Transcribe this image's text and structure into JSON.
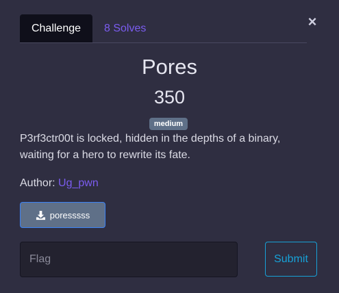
{
  "modal": {
    "close_icon": "close-icon",
    "tabs": [
      {
        "label": "Challenge",
        "active": true
      },
      {
        "label": "8 Solves",
        "active": false
      }
    ],
    "title": "Pores",
    "points": "350",
    "difficulty": "medium",
    "description": "P3rf3ctr00t is locked, hidden in the depths of a binary, waiting for a hero to rewrite its fate.",
    "author_label": "Author: ",
    "author_name": "Ug_pwn",
    "download": {
      "icon": "download-icon",
      "label": "poresssss"
    },
    "flag_placeholder": "Flag",
    "submit_label": "Submit"
  },
  "colors": {
    "background": "#2f2e41",
    "accent": "#7b5cf0",
    "badge": "#5f7088",
    "submit": "#17a2d8"
  }
}
